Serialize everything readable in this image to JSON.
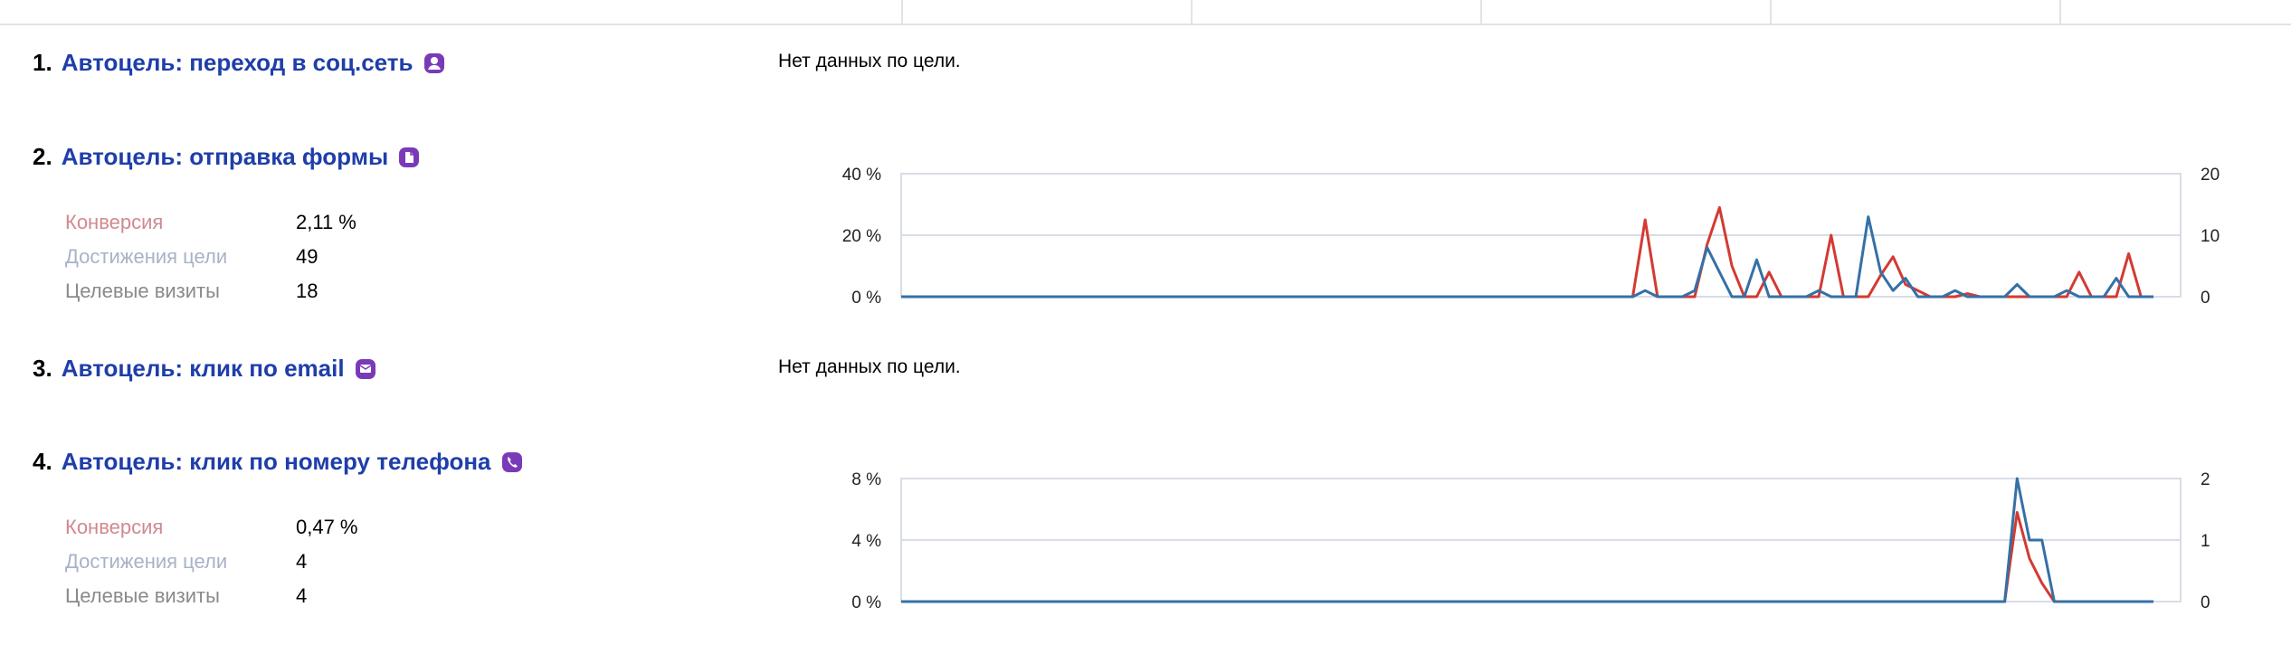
{
  "colors": {
    "link": "#1f3eaa",
    "icon": "#7a3ab8",
    "conversion_label": "#d08a8f",
    "achievements_label": "#a8b2c7",
    "visits_label": "#8a8a8a",
    "line_conversion": "#d33a32",
    "line_achievements": "#3570a6",
    "grid": "#d8dde6"
  },
  "goals": [
    {
      "number": "1.",
      "title": "Автоцель: переход в соц.сеть",
      "icon": "user-icon",
      "no_data": "Нет данных по цели."
    },
    {
      "number": "2.",
      "title": "Автоцель: отправка формы",
      "icon": "form-icon",
      "metrics": {
        "conversion_label": "Конверсия",
        "conversion_value": "2,11 %",
        "achievements_label": "Достижения цели",
        "achievements_value": "49",
        "visits_label": "Целевые визиты",
        "visits_value": "18"
      },
      "chart_data": {
        "type": "line",
        "left_axis_ticks": [
          "0 %",
          "20 %",
          "40 %"
        ],
        "right_axis_ticks": [
          "0",
          "10",
          "20"
        ],
        "ylim_left": [
          0,
          40
        ],
        "ylim_right": [
          0,
          20
        ],
        "series": [
          {
            "color": "#d33a32",
            "axis": "left",
            "values": [
              0,
              0,
              0,
              0,
              0,
              0,
              0,
              0,
              0,
              0,
              0,
              0,
              0,
              0,
              0,
              0,
              0,
              0,
              0,
              0,
              0,
              0,
              0,
              0,
              0,
              0,
              0,
              0,
              0,
              0,
              0,
              0,
              0,
              0,
              0,
              0,
              0,
              0,
              0,
              0,
              0,
              0,
              0,
              0,
              0,
              0,
              0,
              0,
              0,
              0,
              0,
              0,
              0,
              0,
              0,
              0,
              0,
              0,
              0,
              0,
              25,
              0,
              0,
              0,
              0,
              17,
              29,
              10,
              0,
              0,
              8,
              0,
              0,
              0,
              0,
              20,
              0,
              0,
              0,
              7,
              13,
              4,
              2,
              0,
              0,
              0,
              1,
              0,
              0,
              0,
              0,
              0,
              0,
              0,
              0,
              8,
              0,
              0,
              0,
              14,
              0,
              0
            ]
          },
          {
            "color": "#3570a6",
            "axis": "right",
            "values": [
              0,
              0,
              0,
              0,
              0,
              0,
              0,
              0,
              0,
              0,
              0,
              0,
              0,
              0,
              0,
              0,
              0,
              0,
              0,
              0,
              0,
              0,
              0,
              0,
              0,
              0,
              0,
              0,
              0,
              0,
              0,
              0,
              0,
              0,
              0,
              0,
              0,
              0,
              0,
              0,
              0,
              0,
              0,
              0,
              0,
              0,
              0,
              0,
              0,
              0,
              0,
              0,
              0,
              0,
              0,
              0,
              0,
              0,
              0,
              0,
              1,
              0,
              0,
              0,
              1,
              8,
              4,
              0,
              0,
              6,
              0,
              0,
              0,
              0,
              1,
              0,
              0,
              0,
              13,
              4,
              1,
              3,
              0,
              0,
              0,
              1,
              0,
              0,
              0,
              0,
              2,
              0,
              0,
              0,
              1,
              0,
              0,
              0,
              3,
              0,
              0,
              0
            ]
          }
        ]
      }
    },
    {
      "number": "3.",
      "title": "Автоцель: клик по email",
      "icon": "email-icon",
      "no_data": "Нет данных по цели."
    },
    {
      "number": "4.",
      "title": "Автоцель: клик по номеру телефона",
      "icon": "phone-icon",
      "metrics": {
        "conversion_label": "Конверсия",
        "conversion_value": "0,47 %",
        "achievements_label": "Достижения цели",
        "achievements_value": "4",
        "visits_label": "Целевые визиты",
        "visits_value": "4"
      },
      "chart_data": {
        "type": "line",
        "left_axis_ticks": [
          "0 %",
          "4 %",
          "8 %"
        ],
        "right_axis_ticks": [
          "0",
          "1",
          "2"
        ],
        "ylim_left": [
          0,
          8
        ],
        "ylim_right": [
          0,
          2
        ],
        "series": [
          {
            "color": "#d33a32",
            "axis": "left",
            "values": [
              0,
              0,
              0,
              0,
              0,
              0,
              0,
              0,
              0,
              0,
              0,
              0,
              0,
              0,
              0,
              0,
              0,
              0,
              0,
              0,
              0,
              0,
              0,
              0,
              0,
              0,
              0,
              0,
              0,
              0,
              0,
              0,
              0,
              0,
              0,
              0,
              0,
              0,
              0,
              0,
              0,
              0,
              0,
              0,
              0,
              0,
              0,
              0,
              0,
              0,
              0,
              0,
              0,
              0,
              0,
              0,
              0,
              0,
              0,
              0,
              0,
              0,
              0,
              0,
              0,
              0,
              0,
              0,
              0,
              0,
              0,
              0,
              0,
              0,
              0,
              0,
              0,
              0,
              0,
              0,
              0,
              0,
              0,
              0,
              0,
              0,
              0,
              0,
              0,
              0,
              5.8,
              2.8,
              1.2,
              0,
              0,
              0,
              0,
              0,
              0,
              0,
              0,
              0
            ]
          },
          {
            "color": "#3570a6",
            "axis": "right",
            "values": [
              0,
              0,
              0,
              0,
              0,
              0,
              0,
              0,
              0,
              0,
              0,
              0,
              0,
              0,
              0,
              0,
              0,
              0,
              0,
              0,
              0,
              0,
              0,
              0,
              0,
              0,
              0,
              0,
              0,
              0,
              0,
              0,
              0,
              0,
              0,
              0,
              0,
              0,
              0,
              0,
              0,
              0,
              0,
              0,
              0,
              0,
              0,
              0,
              0,
              0,
              0,
              0,
              0,
              0,
              0,
              0,
              0,
              0,
              0,
              0,
              0,
              0,
              0,
              0,
              0,
              0,
              0,
              0,
              0,
              0,
              0,
              0,
              0,
              0,
              0,
              0,
              0,
              0,
              0,
              0,
              0,
              0,
              0,
              0,
              0,
              0,
              0,
              0,
              0,
              0,
              2,
              1,
              1,
              0,
              0,
              0,
              0,
              0,
              0,
              0,
              0,
              0
            ]
          }
        ]
      }
    }
  ]
}
